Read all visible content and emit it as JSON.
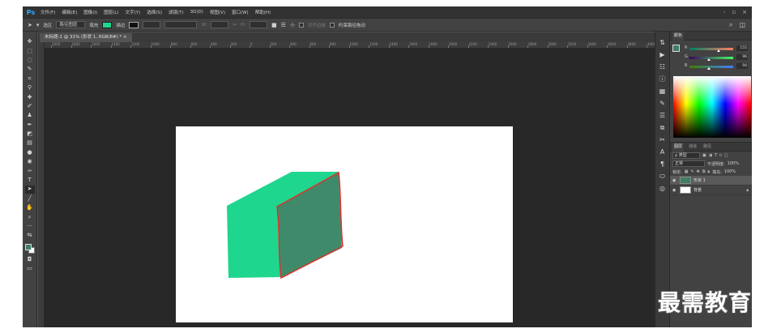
{
  "app": {
    "logo": "Ps",
    "menu": [
      "文件(F)",
      "编辑(E)",
      "图像(I)",
      "图层(L)",
      "文字(Y)",
      "选择(S)",
      "滤镜(T)",
      "3D(D)",
      "视图(V)",
      "窗口(W)",
      "帮助(H)"
    ],
    "window_controls": [
      "-",
      "▫",
      "×"
    ]
  },
  "options_bar": {
    "mode_label": "选区",
    "mode_value": "路径图层",
    "fill_label": "填充",
    "stroke_label": "描边",
    "align_edges": "对齐边缘",
    "constrain_path": "约束路径拖动",
    "fill_color": "#1fd68f",
    "stroke_color": "#111111"
  },
  "document": {
    "tab_title": "未标题-1 @ 31% (形状 1, RGB/8#) *  ×"
  },
  "ruler": {
    "labels": [
      "2000",
      "1800",
      "1600",
      "1400",
      "1200",
      "1000",
      "800",
      "600",
      "400",
      "200",
      "0",
      "200",
      "400",
      "600",
      "800",
      "1000",
      "1200",
      "1400",
      "1600",
      "1800",
      "2000",
      "2200",
      "2400",
      "2600",
      "2800",
      "3000",
      "3200",
      "3400",
      "3600",
      "3800",
      "4000",
      "4200"
    ]
  },
  "color_panel": {
    "tab": "颜色",
    "sliders": [
      {
        "label": "R",
        "value": "155"
      },
      {
        "label": "G",
        "value": "96"
      },
      {
        "label": "B",
        "value": "94"
      }
    ],
    "fg_color": "#3f7f62",
    "bg_color": "#ffffff"
  },
  "layers_panel": {
    "tabs": [
      "图层",
      "通道",
      "路径"
    ],
    "kind_label": "ρ 类型",
    "blend_mode": "正常",
    "opacity_label": "不透明度:",
    "opacity_value": "100%",
    "lock_label": "锁定:",
    "fill_label": "填充:",
    "fill_value": "100%",
    "layers": [
      {
        "name": "形状 1",
        "selected": true,
        "type": "shape"
      },
      {
        "name": "背景",
        "selected": false,
        "type": "background"
      }
    ]
  },
  "watermark": "最需教育"
}
